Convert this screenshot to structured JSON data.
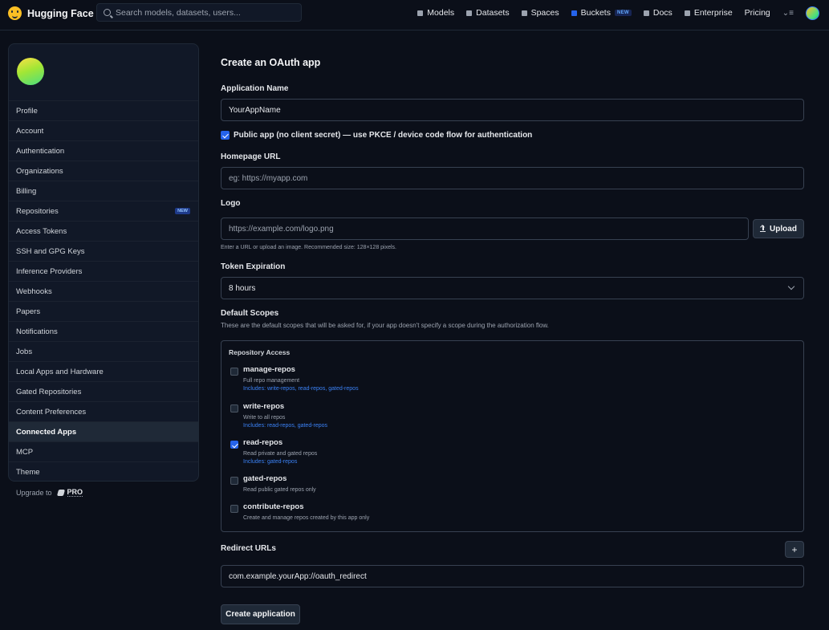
{
  "header": {
    "brand": "Hugging Face",
    "search_placeholder": "Search models, datasets, users...",
    "nav": [
      {
        "label": "Models",
        "icon": "models-icon"
      },
      {
        "label": "Datasets",
        "icon": "datasets-icon"
      },
      {
        "label": "Spaces",
        "icon": "spaces-icon"
      },
      {
        "label": "Buckets",
        "icon": "buckets-icon",
        "badge": "NEW"
      },
      {
        "label": "Docs",
        "icon": "docs-icon"
      },
      {
        "label": "Enterprise",
        "icon": "enterprise-icon"
      },
      {
        "label": "Pricing"
      }
    ]
  },
  "sidebar": {
    "items": [
      {
        "label": "Profile"
      },
      {
        "label": "Account"
      },
      {
        "label": "Authentication"
      },
      {
        "label": "Organizations"
      },
      {
        "label": "Billing"
      },
      {
        "label": "Repositories",
        "badge": "NEW"
      },
      {
        "label": "Access Tokens"
      },
      {
        "label": "SSH and GPG Keys"
      },
      {
        "label": "Inference Providers"
      },
      {
        "label": "Webhooks"
      },
      {
        "label": "Papers"
      },
      {
        "label": "Notifications"
      },
      {
        "label": "Jobs"
      },
      {
        "label": "Local Apps and Hardware"
      },
      {
        "label": "Gated Repositories"
      },
      {
        "label": "Content Preferences"
      },
      {
        "label": "Connected Apps",
        "active": true
      },
      {
        "label": "MCP"
      },
      {
        "label": "Theme"
      }
    ],
    "upgrade_label": "Upgrade to",
    "pro_label": "PRO"
  },
  "form": {
    "title": "Create an OAuth app",
    "app_name_label": "Application Name",
    "app_name_value": "YourAppName",
    "public_app_checked": true,
    "public_app_label": "Public app (no client secret) — use PKCE / device code flow for authentication",
    "homepage_label": "Homepage URL",
    "homepage_placeholder": "eg: https://myapp.com",
    "logo_label": "Logo",
    "logo_placeholder": "https://example.com/logo.png",
    "upload_label": "Upload",
    "logo_hint": "Enter a URL or upload an image. Recommended size: 128×128 pixels.",
    "token_expiration_label": "Token Expiration",
    "token_expiration_value": "8 hours",
    "default_scopes_label": "Default Scopes",
    "default_scopes_desc": "These are the default scopes that will be asked for, if your app doesn't specify a scope during the authorization flow.",
    "repo_access_title": "Repository Access",
    "scopes": [
      {
        "name": "manage-repos",
        "desc": "Full repo management",
        "includes": "Includes: write-repos, read-repos, gated-repos",
        "checked": false
      },
      {
        "name": "write-repos",
        "desc": "Write to all repos",
        "includes": "Includes: read-repos, gated-repos",
        "checked": false
      },
      {
        "name": "read-repos",
        "desc": "Read private and gated repos",
        "includes": "Includes: gated-repos",
        "checked": true
      },
      {
        "name": "gated-repos",
        "desc": "Read public gated repos only",
        "includes": "",
        "checked": false
      },
      {
        "name": "contribute-repos",
        "desc": "Create and manage repos created by this app only",
        "includes": "",
        "checked": false
      }
    ],
    "redirect_label": "Redirect URLs",
    "add_redirect_label": "+",
    "redirect_value": "com.example.yourApp://oauth_redirect",
    "create_button": "Create application"
  },
  "colors": {
    "background": "#0b0f19",
    "panel": "#111827",
    "border": "#374151",
    "accent": "#2563eb",
    "link": "#3b82f6"
  }
}
